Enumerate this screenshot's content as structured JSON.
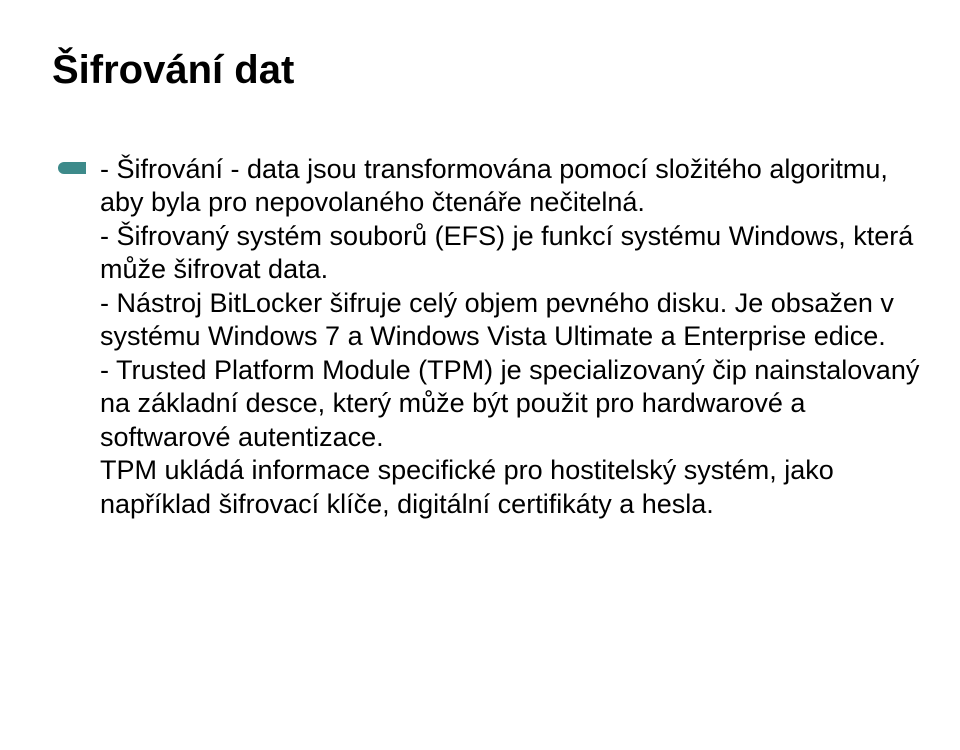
{
  "title": "Šifrování dat",
  "paragraphs": {
    "p1": "- Šifrování - data jsou transformována pomocí složitého algoritmu, aby byla pro nepovolaného čtenáře nečitelná.",
    "p2": "- Šifrovaný systém souborů (EFS) je funkcí systému Windows, která může šifrovat data.",
    "p3": "- Nástroj BitLocker šifruje celý objem pevného disku. Je obsažen v systému Windows 7 a Windows Vista Ultimate a Enterprise edice.",
    "p4": "- Trusted Platform Module (TPM) je specializovaný čip nainstalovaný na základní desce, který může být použit pro hardwarové a softwarové autentizace.",
    "p5": "TPM ukládá informace specifické pro hostitelský systém, jako například šifrovací klíče, digitální certifikáty a hesla."
  }
}
